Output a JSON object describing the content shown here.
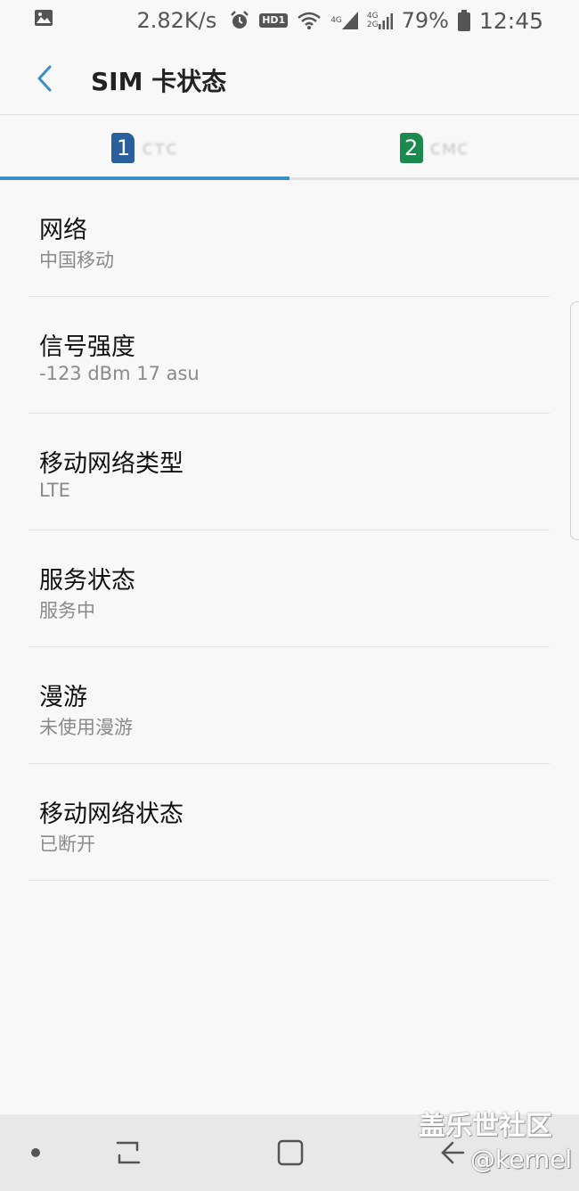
{
  "status_bar": {
    "speed": "2.82K/s",
    "battery_percent": "79%",
    "time": "12:45",
    "network_top": "4G",
    "network_bottom": "2G",
    "hd_badge": "HD1",
    "icons": [
      "image-icon",
      "alarm-icon",
      "hd-icon",
      "wifi-icon",
      "signal-icon",
      "signal-icon",
      "battery-icon"
    ]
  },
  "header": {
    "title": "SIM 卡状态",
    "back_icon": "back-arrow-icon"
  },
  "tabs": [
    {
      "badge": "1",
      "label": "ᴄᴛᴄ",
      "active": true,
      "color": "#2a5f9e"
    },
    {
      "badge": "2",
      "label": "ᴄᴍᴄ",
      "active": false,
      "color": "#1a8a4e"
    }
  ],
  "accent_color": "#3a8fc7",
  "items": [
    {
      "title": "网络",
      "value": "中国移动"
    },
    {
      "title": "信号强度",
      "value": "-123 dBm 17 asu"
    },
    {
      "title": "移动网络类型",
      "value": "LTE"
    },
    {
      "title": "服务状态",
      "value": "服务中"
    },
    {
      "title": "漫游",
      "value": "未使用漫游"
    },
    {
      "title": "移动网络状态",
      "value": "已断开"
    }
  ],
  "nav_bar": {
    "icons": [
      "dot-icon",
      "recent-apps-icon",
      "home-icon",
      "back-icon"
    ]
  },
  "watermark": {
    "line1": "盖乐世社区",
    "line2": "@kernel"
  }
}
